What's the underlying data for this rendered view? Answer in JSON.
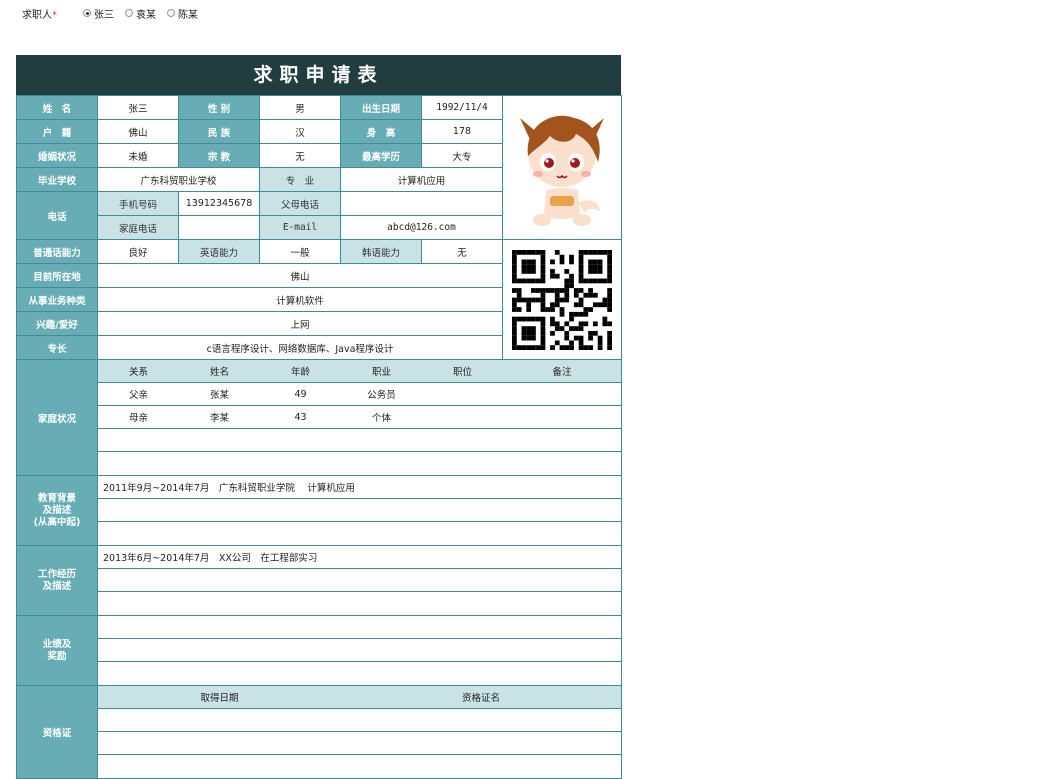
{
  "applicant": {
    "label": "求职人",
    "required_mark": "*",
    "options": [
      "张三",
      "袁某",
      "陈某"
    ],
    "selected": 0
  },
  "form": {
    "title": "求职申请表",
    "name_label": "姓　名",
    "name": "张三",
    "gender_label": "性 别",
    "gender": "男",
    "birth_label": "出生日期",
    "birth": "1992/11/4",
    "hukou_label": "户　籍",
    "hukou": "佛山",
    "ethnic_label": "民 族",
    "ethnic": "汉",
    "height_label": "身　高",
    "height": "178",
    "marital_label": "婚姻状况",
    "marital": "未婚",
    "religion_label": "宗 教",
    "religion": "无",
    "edu_label": "最高学历",
    "edu": "大专",
    "school_label": "毕业学校",
    "school": "广东科贸职业学校",
    "major_label": "专　业",
    "major": "计算机应用",
    "phone_label": "电话",
    "mobile_label": "手机号码",
    "mobile": "13912345678",
    "parent_phone_label": "父母电话",
    "parent_phone": "",
    "home_phone_label": "家庭电话",
    "home_phone": "",
    "email_label": "E-mail",
    "email": "abcd@126.com",
    "mandarin_label": "普通话能力",
    "mandarin": "良好",
    "english_label": "英语能力",
    "english": "一般",
    "korean_label": "韩语能力",
    "korean": "无",
    "location_label": "目前所在地",
    "location": "佛山",
    "industry_label": "从事业务种类",
    "industry": "计算机软件",
    "hobby_label": "兴趣/爱好",
    "hobby": "上网",
    "specialty_label": "专长",
    "specialty": "c语言程序设计、网络数据库、Java程序设计",
    "family_label": "家庭状况",
    "family_headers": [
      "关系",
      "姓名",
      "年龄",
      "职业",
      "职位",
      "备注"
    ],
    "family_rows": [
      [
        "父亲",
        "张某",
        "49",
        "公务员",
        "",
        ""
      ],
      [
        "母亲",
        "李某",
        "43",
        "个体",
        "",
        ""
      ],
      [
        "",
        "",
        "",
        "",
        "",
        ""
      ],
      [
        "",
        "",
        "",
        "",
        "",
        ""
      ]
    ],
    "education_label_1": "教育背景",
    "education_label_2": "及描述",
    "education_label_3": "(从高中起)",
    "education_rows": [
      "2011年9月~2014年7月　广东科贸职业学院　 计算机应用",
      "",
      ""
    ],
    "work_label_1": "工作经历",
    "work_label_2": "及描述",
    "work_rows": [
      "2013年6月~2014年7月　XX公司　在工程部实习",
      "",
      ""
    ],
    "achieve_label_1": "业绩及",
    "achieve_label_2": "奖励",
    "achieve_rows": [
      "",
      "",
      ""
    ],
    "cert_label": "资格证",
    "cert_headers": [
      "取得日期",
      "资格证名"
    ],
    "cert_rows": [
      [
        "",
        ""
      ],
      [
        "",
        ""
      ],
      [
        "",
        ""
      ]
    ]
  }
}
